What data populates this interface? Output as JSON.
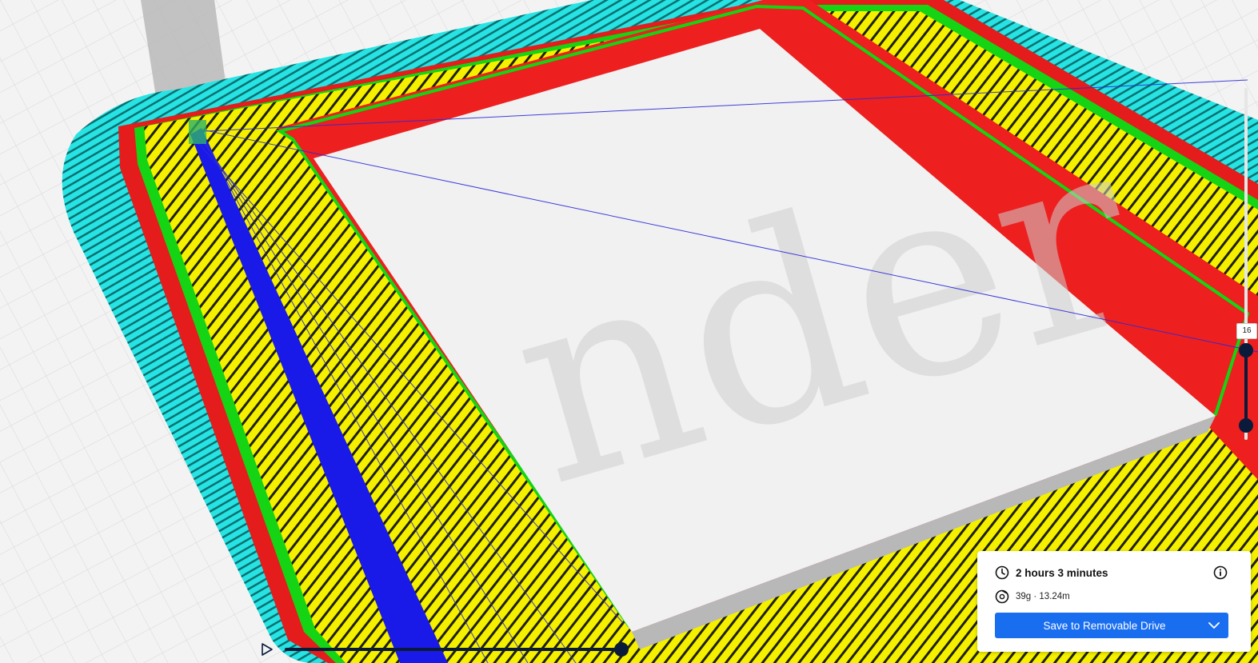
{
  "layer_view": {
    "current_layer": "16"
  },
  "print_info": {
    "print_time": "2 hours 3 minutes",
    "material": "39g · 13.24m",
    "save_label": "Save to Removable Drive"
  },
  "icons": {
    "play": "play-icon",
    "clock": "clock-icon",
    "spool": "spool-icon",
    "info": "info-icon",
    "dropdown": "chevron-down-icon"
  },
  "colors": {
    "skirt": "#25e5e5",
    "outer_wall": "#ee1f1f",
    "inner_wall": "#14d414",
    "skin": "#f4f000",
    "travel": "#1a1ae8",
    "accent": "#196ef0",
    "slider": "#0a1a3a"
  }
}
